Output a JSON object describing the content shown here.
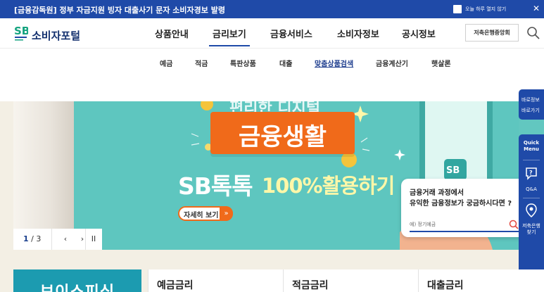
{
  "alert": {
    "text": "[금융감독원] 정부 자금지원 빙자 대출사기 문자 소비자경보 발령",
    "checkbox_label": "오늘 하루 열지 않기",
    "close_symbol": "✕"
  },
  "header": {
    "logo_text": "소비자포털",
    "nav": [
      "상품안내",
      "금리보기",
      "금융서비스",
      "소비자정보",
      "공시정보"
    ],
    "active_nav": "금리보기",
    "association_button": "저축은행중앙회",
    "accent_color": "#1f4aa8"
  },
  "subnav": {
    "items": [
      "예금",
      "적금",
      "특판상품",
      "대출",
      "맞춤상품검색",
      "금융계산기",
      "햇살론"
    ],
    "active_item": "맞춤상품검색"
  },
  "hero": {
    "top_text": "편리한 디지털",
    "badge_text": "금융생활",
    "title_main": "SB톡톡",
    "title_sub": "100%활용하기",
    "detail_button": "자세히 보기",
    "detail_arrow": "»",
    "brand_color": "#f06a1a",
    "bg_color": "#5ec6bf"
  },
  "slider": {
    "current": "1",
    "separator": " / ",
    "total": "3",
    "prev_symbol": "‹",
    "next_symbol": "›",
    "pause_symbol": "II"
  },
  "quick_search": {
    "line1": "금융거래 과정에서",
    "line2": "유익한 금융정보가 궁금하시다면 ?",
    "placeholder": "예) 정기예금"
  },
  "side": {
    "top_line1": "바로정보",
    "top_line2": "바로가기",
    "quick_menu_title": "Quick\nMenu",
    "qa_label": "Q&A",
    "branch_label": "저축은행\n찾기"
  },
  "bottom": {
    "promo_text": "보이스피싱",
    "cards": [
      "예금금리",
      "적금금리",
      "대출금리"
    ]
  }
}
